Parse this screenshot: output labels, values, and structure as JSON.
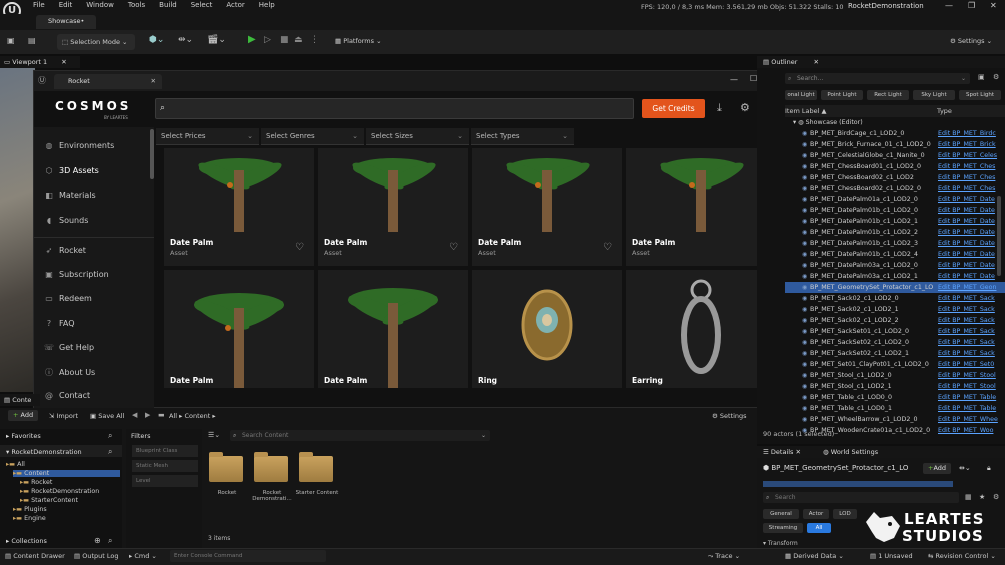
{
  "titlebar": {
    "menu": [
      "File",
      "Edit",
      "Window",
      "Tools",
      "Build",
      "Select",
      "Actor",
      "Help"
    ],
    "stats": "FPS: 120,0  / 8,3 ms  Mem: 3.561,29 mb  Objs: 51.322  Stalls: 10",
    "project": "RocketDemonstration"
  },
  "doc_tab": "Showcase•",
  "toolbar": {
    "mode": "Selection Mode",
    "platforms": "Platforms",
    "settings": "Settings"
  },
  "viewport": {
    "tab": "Viewport 1"
  },
  "rocket": {
    "tab": "Rocket",
    "brand": "COSMOS",
    "brand_sub": "BY LEARTES",
    "search_placeholder": "",
    "credits_btn": "Get Credits",
    "sidebar": [
      {
        "icon": "globe-icon",
        "label": "Environments"
      },
      {
        "icon": "cube-icon",
        "label": "3D Assets"
      },
      {
        "icon": "materials-icon",
        "label": "Materials"
      },
      {
        "icon": "sound-icon",
        "label": "Sounds"
      },
      {
        "icon": "rocket-icon",
        "label": "Rocket"
      },
      {
        "icon": "subscription-icon",
        "label": "Subscription"
      },
      {
        "icon": "redeem-icon",
        "label": "Redeem"
      },
      {
        "icon": "faq-icon",
        "label": "FAQ"
      },
      {
        "icon": "help-icon",
        "label": "Get Help"
      },
      {
        "icon": "info-icon",
        "label": "About Us"
      },
      {
        "icon": "contact-icon",
        "label": "Contact"
      }
    ],
    "filters": [
      "Select Prices",
      "Select Genres",
      "Select Sizes",
      "Select Types"
    ],
    "cards": [
      {
        "title": "Date Palm",
        "sub": "Asset"
      },
      {
        "title": "Date Palm",
        "sub": "Asset"
      },
      {
        "title": "Date Palm",
        "sub": "Asset"
      },
      {
        "title": "Date Palm",
        "sub": "Asset"
      },
      {
        "title": "Date Palm",
        "sub": ""
      },
      {
        "title": "Date Palm",
        "sub": ""
      },
      {
        "title": "Ring",
        "sub": ""
      },
      {
        "title": "Earring",
        "sub": ""
      }
    ]
  },
  "outliner": {
    "tab": "Outliner",
    "search_placeholder": "Search...",
    "lights": [
      "onal Light",
      "Point Light",
      "Rect Light",
      "Sky Light",
      "Spot Light"
    ],
    "col_label": "Item Label ▲",
    "col_type": "Type",
    "root": "Showcase (Editor)",
    "rows": [
      {
        "n": "BP_MET_BirdCage_c1_LOD2_0",
        "t": "Edit BP_MET_Birdc"
      },
      {
        "n": "BP_MET_Brick_Furnace_01_c1_LOD2_0",
        "t": "Edit BP_MET_Brick"
      },
      {
        "n": "BP_MET_CelestialGlobe_c1_Nanite_0",
        "t": "Edit BP_MET_Celes"
      },
      {
        "n": "BP_MET_ChessBoard01_c1_LOD2_0",
        "t": "Edit BP_MET_Ches"
      },
      {
        "n": "BP_MET_ChessBoard02_c1_LOD2",
        "t": "Edit BP_MET_Ches"
      },
      {
        "n": "BP_MET_ChessBoard02_c1_LOD2_0",
        "t": "Edit BP_MET_Ches"
      },
      {
        "n": "BP_MET_DatePalm01a_c1_LOD2_0",
        "t": "Edit BP_MET_Date"
      },
      {
        "n": "BP_MET_DatePalm01b_c1_LOD2_0",
        "t": "Edit BP_MET_Date"
      },
      {
        "n": "BP_MET_DatePalm01b_c1_LOD2_1",
        "t": "Edit BP_MET_Date"
      },
      {
        "n": "BP_MET_DatePalm01b_c1_LOD2_2",
        "t": "Edit BP_MET_Date"
      },
      {
        "n": "BP_MET_DatePalm01b_c1_LOD2_3",
        "t": "Edit BP_MET_Date"
      },
      {
        "n": "BP_MET_DatePalm01b_c1_LOD2_4",
        "t": "Edit BP_MET_Date"
      },
      {
        "n": "BP_MET_DatePalm03a_c1_LOD2_0",
        "t": "Edit BP_MET_Date"
      },
      {
        "n": "BP_MET_DatePalm03a_c1_LOD2_1",
        "t": "Edit BP_MET_Date"
      },
      {
        "n": "BP_MET_GeometrySet_Protactor_c1_LO",
        "t": "Edit BP_MET_Geon",
        "sel": true
      },
      {
        "n": "BP_MET_Sack02_c1_LOD2_0",
        "t": "Edit BP_MET_Sack"
      },
      {
        "n": "BP_MET_Sack02_c1_LOD2_1",
        "t": "Edit BP_MET_Sack"
      },
      {
        "n": "BP_MET_Sack02_c1_LOD2_2",
        "t": "Edit BP_MET_Sack"
      },
      {
        "n": "BP_MET_SackSet01_c1_LOD2_0",
        "t": "Edit BP_MET_Sack"
      },
      {
        "n": "BP_MET_SackSet02_c1_LOD2_0",
        "t": "Edit BP_MET_Sack"
      },
      {
        "n": "BP_MET_SackSet02_c1_LOD2_1",
        "t": "Edit BP_MET_Sack"
      },
      {
        "n": "BP_MET_Set01_ClayPot01_c1_LOD2_0",
        "t": "Edit BP_MET_Set0"
      },
      {
        "n": "BP_MET_Stool_c1_LOD2_0",
        "t": "Edit BP_MET_Stool"
      },
      {
        "n": "BP_MET_Stool_c1_LOD2_1",
        "t": "Edit BP_MET_Stool"
      },
      {
        "n": "BP_MET_Table_c1_LOD0_0",
        "t": "Edit BP_MET_Table"
      },
      {
        "n": "BP_MET_Table_c1_LOD0_1",
        "t": "Edit BP_MET_Table"
      },
      {
        "n": "BP_MET_WheelBarrow_c1_LOD2_0",
        "t": "Edit BP_MET_Whee"
      },
      {
        "n": "BP_MET_WoodenCrate01a_c1_LOD2_0",
        "t": "Edit BP_MET_Woo"
      }
    ],
    "count": "90 actors (1 selected)"
  },
  "content": {
    "tab": "Conte",
    "add": "Add",
    "import": "Import",
    "save_all": "Save All",
    "path": [
      "All",
      "Content"
    ],
    "settings": "Settings",
    "favorites": "Favorites",
    "project": "RocketDemonstration",
    "tree": [
      {
        "label": "All",
        "lvl": 0
      },
      {
        "label": "Content",
        "lvl": 1,
        "sel": true
      },
      {
        "label": "Rocket",
        "lvl": 2
      },
      {
        "label": "RocketDemonstration",
        "lvl": 2
      },
      {
        "label": "StarterContent",
        "lvl": 2
      },
      {
        "label": "Plugins",
        "lvl": 1
      },
      {
        "label": "Engine",
        "lvl": 1
      }
    ],
    "collections": "Collections",
    "filters_title": "Filters",
    "filter_items": [
      "Blueprint Class",
      "Static Mesh",
      "Level"
    ],
    "search_placeholder": "Search Content",
    "folders": [
      "Rocket",
      "Rocket Demonstrati...",
      "Starter Content"
    ],
    "items_count": "3 items"
  },
  "details": {
    "tab": "Details",
    "world": "World Settings",
    "object": "BP_MET_GeometrySet_Protactor_c1_LO",
    "add": "Add",
    "search_placeholder": "Search",
    "filters": [
      "General",
      "Actor",
      "LOD",
      "Streaming",
      "All"
    ],
    "section": "Transform"
  },
  "watermark": {
    "line1": "LEARTES",
    "line2": "STUDIOS"
  },
  "bottom": {
    "drawer": "Content Drawer",
    "output": "Output Log",
    "cmd": "Cmd",
    "console_placeholder": "Enter Console Command",
    "trace": "Trace",
    "derived": "Derived Data",
    "unsaved": "1 Unsaved",
    "revision": "Revision Control"
  }
}
